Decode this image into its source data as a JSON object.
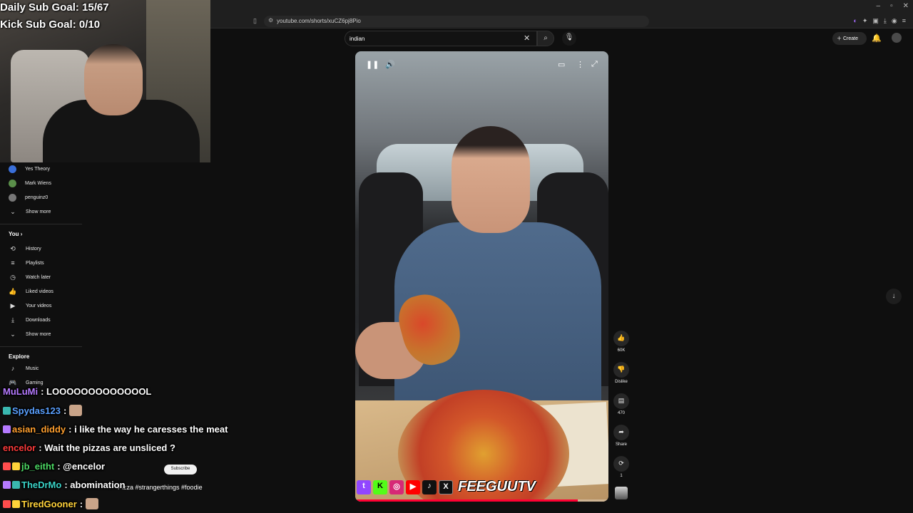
{
  "browser": {
    "url": "youtube.com/shorts/xuCZ6pj8Pio",
    "window_buttons": [
      "–",
      "▫",
      "✕"
    ]
  },
  "stream_overlay": {
    "daily_sub_goal": "Daily Sub Goal: 15/67",
    "kick_sub_goal": "Kick Sub Goal: 0/10"
  },
  "sidebar": {
    "subscriptions": [
      {
        "label": "Yes Theory",
        "color": "#3a6fd8"
      },
      {
        "label": "Mark Wiens",
        "color": "#5a8f4a"
      },
      {
        "label": "penguinz0",
        "color": "#777777"
      }
    ],
    "subs_show_more": "Show more",
    "you_heading": "You",
    "you_items": [
      {
        "icon": "history-icon",
        "glyph": "⟲",
        "label": "History"
      },
      {
        "icon": "playlists-icon",
        "glyph": "≡",
        "label": "Playlists"
      },
      {
        "icon": "watch-later-icon",
        "glyph": "◷",
        "label": "Watch later"
      },
      {
        "icon": "liked-videos-icon",
        "glyph": "👍",
        "label": "Liked videos"
      },
      {
        "icon": "your-videos-icon",
        "glyph": "▶",
        "label": "Your videos"
      },
      {
        "icon": "downloads-icon",
        "glyph": "⤓",
        "label": "Downloads"
      }
    ],
    "you_show_more": "Show more",
    "explore_heading": "Explore",
    "explore_items": [
      {
        "icon": "music-icon",
        "glyph": "♪",
        "label": "Music"
      },
      {
        "icon": "gaming-icon",
        "glyph": "🎮",
        "label": "Gaming"
      }
    ]
  },
  "search": {
    "value": "indian"
  },
  "header": {
    "create_label": "Create"
  },
  "video": {
    "progress_fraction": 0.88,
    "description": "Pizza #strangerthings #foodie",
    "brand_text": "FEEGUUTV"
  },
  "actions": {
    "like_count": "60K",
    "dislike_label": "Dislike",
    "comments_count": "470",
    "share_label": "Share",
    "remix_count": "1"
  },
  "subscribe_label": "Subscribe",
  "chat": [
    {
      "user": "MuLuMi",
      "user_color": "#b57aff",
      "message": ": LOOOOOOOOOOOOOL",
      "emote": false
    },
    {
      "user": "Spydas123",
      "user_color": "#5aa0ff",
      "message": " :",
      "emote": true
    },
    {
      "user": "asian_diddy",
      "user_color": "#ff9f2e",
      "message": ": i like the way he caresses the meat",
      "emote": false
    },
    {
      "user": "encelor",
      "user_color": "#ff3b3b",
      "message": ": Wait the pizzas are unsliced ?",
      "emote": false
    },
    {
      "user": "jb_eitht",
      "user_color": "#4cd964",
      "message": ": @encelor",
      "emote": false
    },
    {
      "user": "TheDrMo",
      "user_color": "#3ad4c8",
      "message": ": abomination",
      "emote": false
    },
    {
      "user": "TiredGooner",
      "user_color": "#ffd23a",
      "message": " :",
      "emote": true
    }
  ]
}
